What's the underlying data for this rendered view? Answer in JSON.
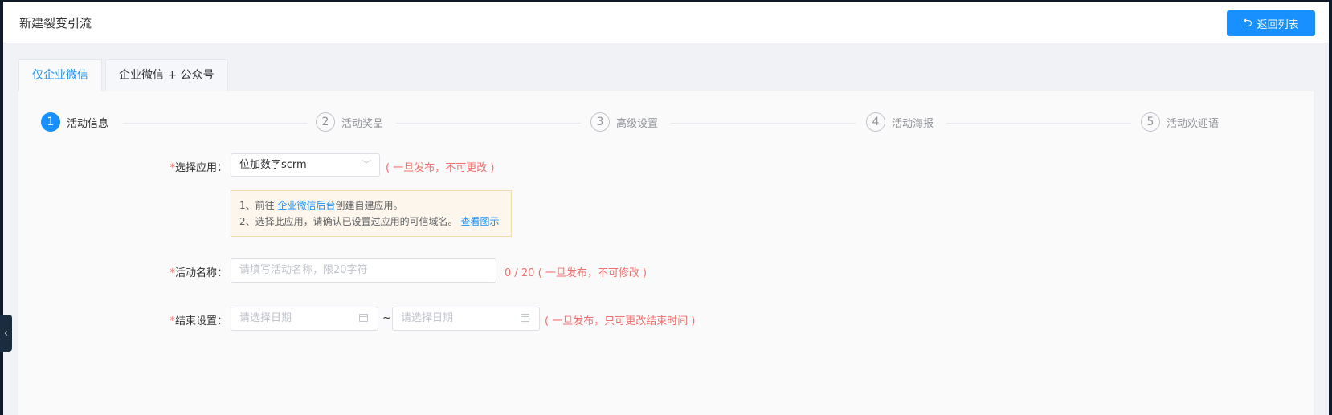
{
  "header": {
    "title": "新建裂变引流",
    "back_button": "返回列表"
  },
  "tabs": [
    {
      "label": "仅企业微信",
      "active": true
    },
    {
      "label": "企业微信 + 公众号",
      "active": false
    }
  ],
  "steps": [
    {
      "num": "1",
      "label": "活动信息",
      "active": true
    },
    {
      "num": "2",
      "label": "活动奖品",
      "active": false
    },
    {
      "num": "3",
      "label": "高级设置",
      "active": false
    },
    {
      "num": "4",
      "label": "活动海报",
      "active": false
    },
    {
      "num": "5",
      "label": "活动欢迎语",
      "active": false
    }
  ],
  "form": {
    "app": {
      "required": "*",
      "label": "选择应用：",
      "value": "位加数字scrm",
      "note": "( 一旦发布，不可更改 )"
    },
    "notice": {
      "line1_prefix": "1、前往 ",
      "line1_link": "企业微信后台",
      "line1_suffix": "创建自建应用。",
      "line2_text": "2、选择此应用，请确认已设置过应用的可信域名。",
      "line2_link": "查看图示"
    },
    "name": {
      "required": "*",
      "label": "活动名称：",
      "placeholder": "请填写活动名称，限20字符",
      "counter": "0 / 20",
      "note": "( 一旦发布，不可修改 )"
    },
    "end": {
      "required": "*",
      "label": "结束设置：",
      "date_placeholder_1": "请选择日期",
      "separator": "~",
      "date_placeholder_2": "请选择日期",
      "note": "( 一旦发布，只可更改结束时间 )"
    }
  },
  "icons": {
    "back": "return-icon",
    "chevron": "chevron-down-icon",
    "calendar": "calendar-icon",
    "collapse": "chevron-left-icon"
  },
  "colors": {
    "primary": "#1890ff",
    "danger": "#f56c6c",
    "notice_bg": "#fdf6ec"
  }
}
